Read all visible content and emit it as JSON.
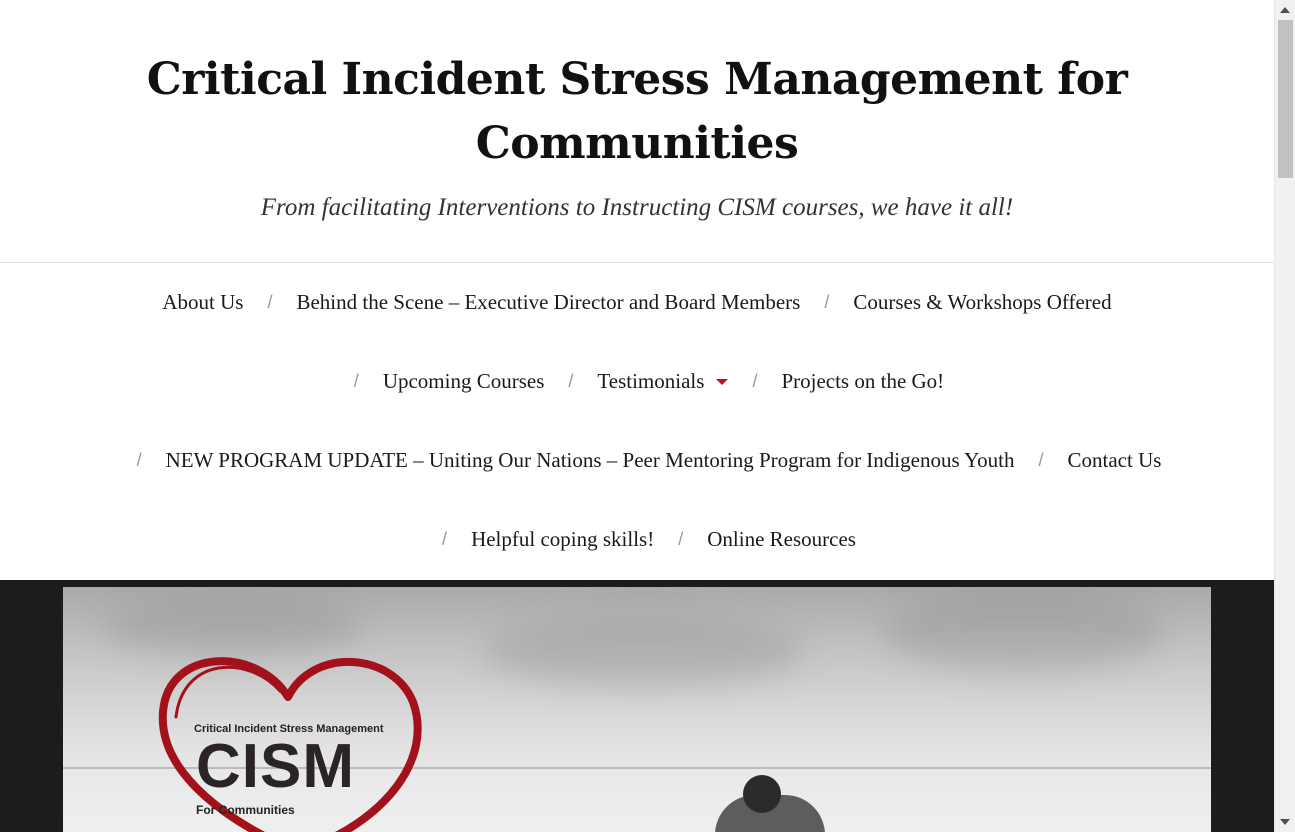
{
  "site": {
    "title": "Critical Incident Stress Management for Communities",
    "description": "From facilitating Interventions to Instructing CISM courses, we have it all!"
  },
  "nav": {
    "separator": "/",
    "items": [
      {
        "label": "About Us"
      },
      {
        "label": "Behind the Scene – Executive Director and Board Members"
      },
      {
        "label": "Courses & Workshops Offered"
      },
      {
        "label": "Upcoming Courses"
      },
      {
        "label": "Testimonials",
        "has_dropdown": true
      },
      {
        "label": "Projects on the Go!"
      },
      {
        "label": "NEW PROGRAM UPDATE – Uniting Our Nations – Peer Mentoring Program for Indigenous Youth"
      },
      {
        "label": "Contact Us"
      },
      {
        "label": "Helpful coping skills!"
      },
      {
        "label": "Online Resources"
      }
    ],
    "dropdown_color": "#c0101a"
  },
  "hero": {
    "logo": {
      "subtitle": "Critical Incident Stress Management",
      "name": "CISM",
      "tagline": "For Communities",
      "heart_color": "#a3121b"
    }
  }
}
